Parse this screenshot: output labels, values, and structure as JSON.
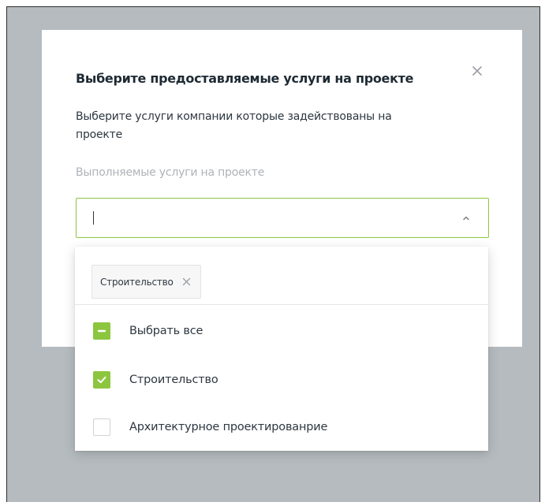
{
  "modal": {
    "title": "Выберите предоставляемые услуги на проекте",
    "description": "Выберите услуги компании которые задействованы на проекте",
    "field_label": "Выполняемые услуги на проекте",
    "input_value": "",
    "close_icon": "close-icon"
  },
  "dropdown": {
    "selected_chips": [
      {
        "label": "Строительство",
        "remove_icon": "close-icon"
      }
    ],
    "options": [
      {
        "label": "Выбрать все",
        "state": "indeterminate"
      },
      {
        "label": "Строительство",
        "state": "checked"
      },
      {
        "label": "Архитектурное проектированрие",
        "state": "unchecked"
      }
    ]
  },
  "colors": {
    "accent": "#8cc63f",
    "overlay": "#b5bbbf",
    "title": "#1e2a33",
    "muted": "#aeb3b8"
  }
}
